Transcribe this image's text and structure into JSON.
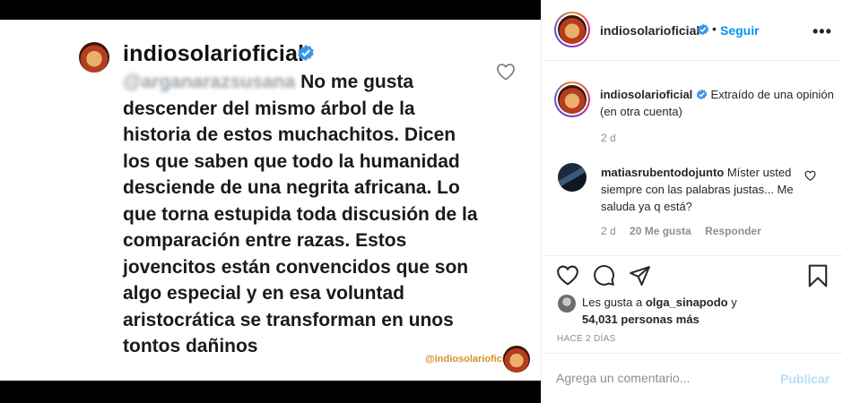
{
  "post_image": {
    "username": "indiosolarioficial",
    "blurred_handle": "@arganarazsusana",
    "text": "No me gusta descender del mismo árbol de la historia de estos muchachitos. Dicen los que saben que todo la humanidad desciende de una negrita africana. Lo que torna estupida toda discusión de la comparación entre razas. Estos jovencitos están convencidos que son algo especial y en esa voluntad aristocrática se transforman en unos tontos dañinos",
    "watermark": "@indiosolarioficial"
  },
  "header": {
    "username": "indiosolarioficial",
    "separator": "•",
    "follow_label": "Seguir",
    "more_icon": "more-options-icon"
  },
  "caption": {
    "username": "indiosolarioficial",
    "text": "Extraído de una opinión (en otra cuenta)",
    "time": "2 d"
  },
  "comment": {
    "username": "matiasrubentodojunto",
    "text": "Míster usted siempre con las palabras justas... Me saluda ya q está?",
    "time": "2 d",
    "likes": "20 Me gusta",
    "reply_label": "Responder"
  },
  "likes": {
    "prefix": "Les gusta a",
    "user": "olga_sinapodo",
    "conjunction": "y",
    "count": "54,031 personas más"
  },
  "time_ago": "HACE 2 DÍAS",
  "comment_box": {
    "placeholder": "Agrega un comentario...",
    "publish_label": "Publicar"
  },
  "colors": {
    "link_blue": "#0095f6",
    "verified_blue": "#3897f0",
    "publish_disabled": "#b2dffc"
  }
}
